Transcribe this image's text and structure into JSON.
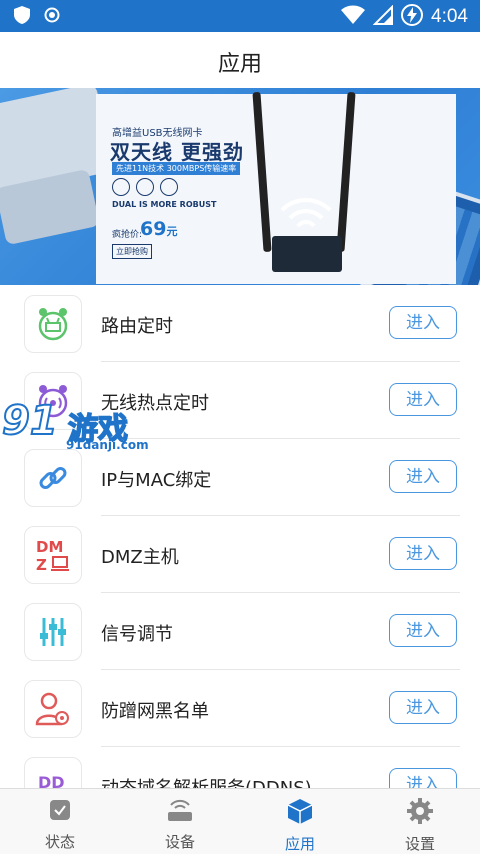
{
  "status_bar": {
    "time": "4:04"
  },
  "app_bar": {
    "title": "应用"
  },
  "banner": {
    "subtitle": "高增益USB无线网卡",
    "headline": "双天线 更强劲",
    "tagline": "先进11N技术 300MBPS传输速率",
    "english": "DUAL IS MORE ROBUST",
    "price_label": "疯抢价:",
    "price": "69",
    "price_unit": "元",
    "buy_label": "立即抢购"
  },
  "apps": [
    {
      "label": "路由定时",
      "button": "进入",
      "icon": "alarm-router-icon",
      "color": "#5cc46a"
    },
    {
      "label": "无线热点定时",
      "button": "进入",
      "icon": "alarm-wifi-icon",
      "color": "#8e5bd6"
    },
    {
      "label": "IP与MAC绑定",
      "button": "进入",
      "icon": "link-icon",
      "color": "#3a8be0"
    },
    {
      "label": "DMZ主机",
      "button": "进入",
      "icon": "dmz-icon",
      "color": "#e04a4a"
    },
    {
      "label": "信号调节",
      "button": "进入",
      "icon": "sliders-icon",
      "color": "#3bbcd6"
    },
    {
      "label": "防蹭网黑名单",
      "button": "进入",
      "icon": "user-block-icon",
      "color": "#e05a5a"
    },
    {
      "label": "动态域名解析服务(DDNS)",
      "button": "进入",
      "icon": "ddns-icon",
      "color": "#9a5cd6"
    }
  ],
  "tabs": [
    {
      "label": "状态",
      "icon": "status-icon",
      "active": false
    },
    {
      "label": "设备",
      "icon": "device-icon",
      "active": false
    },
    {
      "label": "应用",
      "icon": "cube-icon",
      "active": true
    },
    {
      "label": "设置",
      "icon": "gear-icon",
      "active": false
    }
  ],
  "watermark": {
    "number": "91",
    "brand": "游戏",
    "url": "91danji.com"
  },
  "colors": {
    "primary": "#1f73c8",
    "button": "#4a97e0"
  }
}
